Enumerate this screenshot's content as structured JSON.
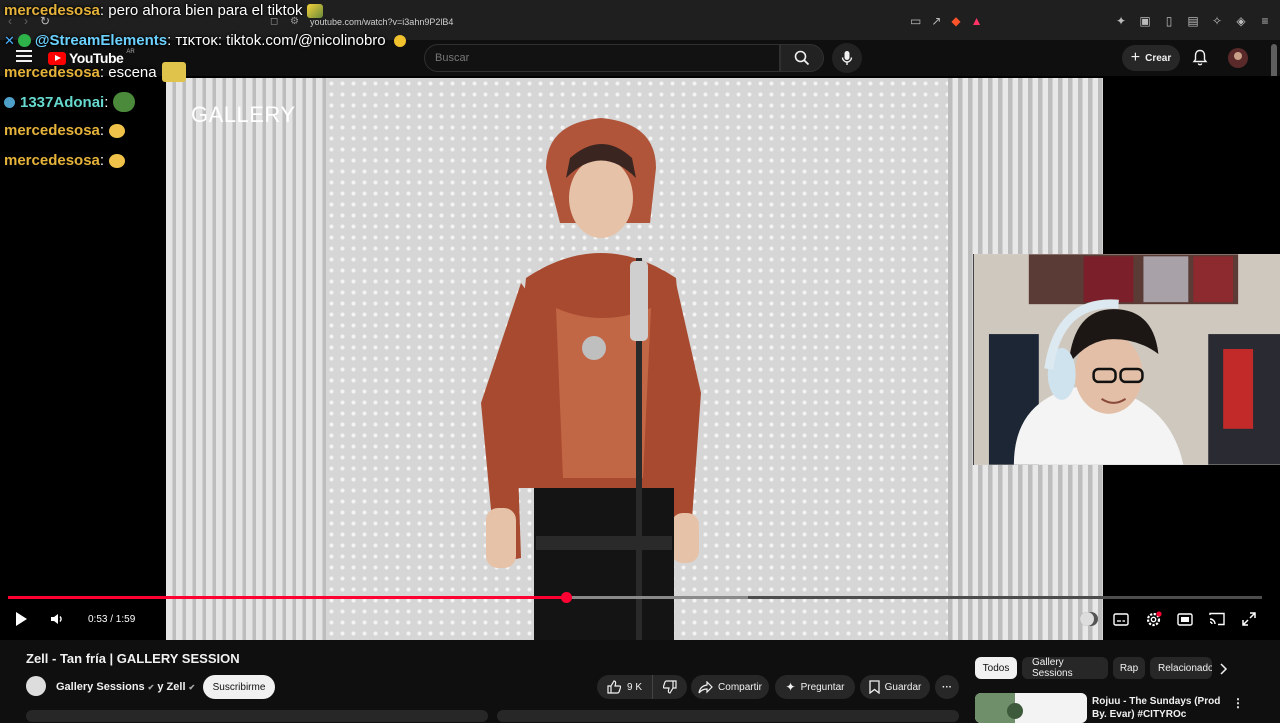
{
  "browser": {
    "url": "youtube.com/watch?v=i3ahn9P2lB4"
  },
  "header": {
    "logo_text": "YouTube",
    "logo_region": "AR",
    "search_placeholder": "Buscar",
    "create_label": "Crear"
  },
  "video": {
    "watermark": "GALLERY",
    "current_time": "0:53",
    "duration": "1:59",
    "time_display": "0:53 / 1:59",
    "progress_fraction": 0.445,
    "buffered_fraction": 0.59
  },
  "chat": [
    {
      "user": "mercedesosa",
      "message": ": pero ahora bien para el tiktok",
      "style": "gold"
    },
    {
      "user": "@StreamElements",
      "message": ": ᴛɪᴋᴛᴏᴋ: tiktok.com/@nicolinobro",
      "style": "se"
    },
    {
      "user": "mercedesosa",
      "message": ": escena",
      "style": "gold"
    },
    {
      "user": "1337Adonai",
      "message": ":",
      "style": "cyan"
    },
    {
      "user": "mercedesosa",
      "message": ":",
      "style": "gold"
    },
    {
      "user": "mercedesosa",
      "message": ":",
      "style": "gold"
    }
  ],
  "below": {
    "title": "Zell - Tan fría | GALLERY SESSION",
    "channel_primary": "Gallery Sessions",
    "channel_join": "y Zell",
    "subscribe_label": "Suscribirme",
    "like_count": "9 K",
    "share_label": "Compartir",
    "ask_label": "Preguntar",
    "save_label": "Guardar"
  },
  "sidebar": {
    "chips": [
      "Todos",
      "Gallery Sessions",
      "Rap",
      "Relacionado"
    ],
    "recommendation_title": "Rojuu - The Sundays (Prod By. Evar) #CITYROc"
  },
  "colors": {
    "accent_red": "#ff0033",
    "chat_gold": "#e6b33a",
    "chat_cyan": "#66d9cf"
  }
}
